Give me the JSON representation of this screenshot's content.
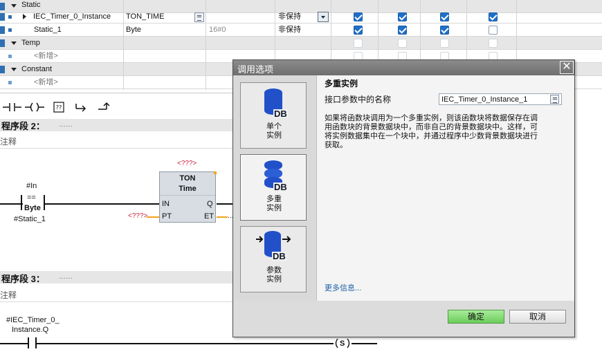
{
  "interface_table": {
    "rows": [
      {
        "name": "Static"
      },
      {
        "name": "IEC_Timer_0_Instance",
        "type": "TON_TIME",
        "retain": "非保持",
        "checks": [
          true,
          true,
          true,
          true
        ]
      },
      {
        "name": "Static_1",
        "type": "Byte",
        "default": "16#0",
        "retain": "非保持",
        "checks": [
          true,
          true,
          true,
          false
        ]
      },
      {
        "name": "Temp"
      },
      {
        "name": "<新增>"
      },
      {
        "name": "Constant"
      },
      {
        "name": "<新增>"
      }
    ]
  },
  "network2": {
    "title": "程序段 2：",
    "dots": "……",
    "comment": "注释",
    "contact_operand_top": "#In",
    "contact_op": "==",
    "contact_type": "Byte",
    "contact_operand_bottom": "#Static_1",
    "ton_instance": "<???>",
    "ton_name": "TON",
    "ton_type": "Time",
    "pin_in": "IN",
    "pin_pt": "PT",
    "pin_q": "Q",
    "pin_et": "ET",
    "pt_value": "<???>",
    "et_value": "..."
  },
  "network3": {
    "title": "程序段 3：",
    "dots": "……",
    "comment": "注释",
    "contact_operand_line1": "#IEC_Timer_0_",
    "contact_operand_line2": "Instance.Q",
    "coil_label": "S"
  },
  "dialog": {
    "title": "调用选项",
    "close": "✕",
    "options": [
      {
        "line1": "单个",
        "line2": "实例",
        "icon": "single-instance-db-icon",
        "db_text": "DB"
      },
      {
        "line1": "多重",
        "line2": "实例",
        "icon": "multi-instance-db-icon",
        "db_text": "DB"
      },
      {
        "line1": "参数",
        "line2": "实例",
        "icon": "parameter-instance-db-icon",
        "db_text": "DB"
      }
    ],
    "heading": "多重实例",
    "field_label": "接口参数中的名称",
    "field_value": "IEC_Timer_0_Instance_1",
    "description_lines": [
      "如果将函数块调用为一个多重实例，则该函数块将数据保存在调",
      "用函数块的背景数据块中，而非自己的背景数据块中。这样，可",
      "将实例数据集中在一个块中，并通过程序中少数背景数据块进行",
      "获取。"
    ],
    "more_info": "更多信息...",
    "ok": "确定",
    "cancel": "取消"
  },
  "colors": {
    "accent_blue": "#1f6fc9",
    "ok_green": "#6ccd5b",
    "db_blue": "#2150c9",
    "link_blue": "#1a5ea8",
    "placeholder_red": "#c8223b"
  }
}
